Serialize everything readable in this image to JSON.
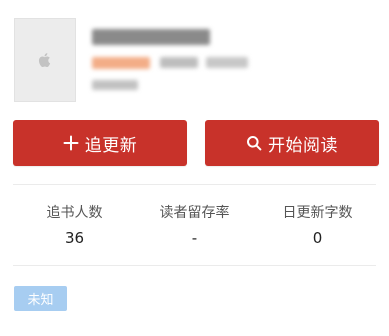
{
  "book": {
    "cover_alt": "book-cover-placeholder"
  },
  "actions": {
    "follow_label": "追更新",
    "read_label": "开始阅读"
  },
  "stats": [
    {
      "label": "追书人数",
      "value": "36"
    },
    {
      "label": "读者留存率",
      "value": "-"
    },
    {
      "label": "日更新字数",
      "value": "0"
    }
  ],
  "tag": {
    "label": "未知"
  },
  "colors": {
    "primary_button": "#c8322a",
    "tag_bg": "#a7cdf1"
  },
  "icons": {
    "follow": "plus-icon",
    "read": "search-icon",
    "cover": "apple-logo-icon"
  }
}
